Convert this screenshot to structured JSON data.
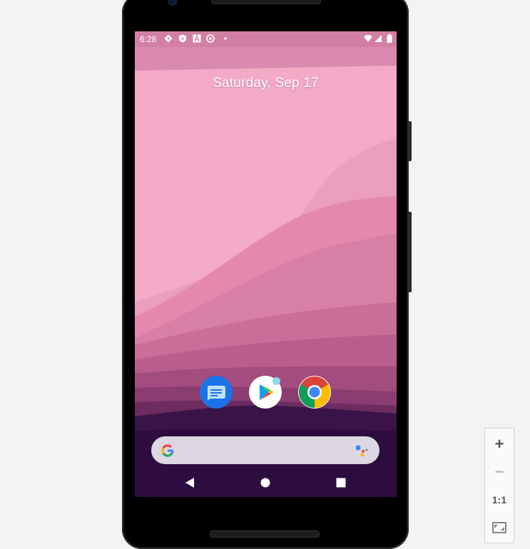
{
  "status_bar": {
    "time": "6:28",
    "left_icons": [
      "gear-icon",
      "shield-icon",
      "font-icon",
      "vpn-icon",
      "small-dot"
    ],
    "right_icons": [
      "wifi-icon",
      "signal-icon",
      "battery-icon"
    ]
  },
  "home": {
    "date": "Saturday, Sep 17",
    "dock_apps": [
      {
        "name": "Messages",
        "icon": "messages-icon"
      },
      {
        "name": "Play Store",
        "icon": "play-store-icon",
        "has_notification": true
      },
      {
        "name": "Chrome",
        "icon": "chrome-icon"
      }
    ],
    "search_bar": {
      "logo": "google-g-icon",
      "assistant": "assistant-icon"
    }
  },
  "nav_bar": {
    "back": "back-icon",
    "home": "home-icon",
    "recents": "recents-icon"
  },
  "zoom_controls": {
    "zoom_in": "+",
    "zoom_out": "−",
    "actual_size": "1:1",
    "fit": "fit-screen-icon"
  },
  "colors": {
    "wallpaper_top": "#f2a9c6",
    "wallpaper_mid": "#e084a9",
    "wallpaper_dark": "#2d0d40",
    "search_bar": "#dcd7e2"
  }
}
